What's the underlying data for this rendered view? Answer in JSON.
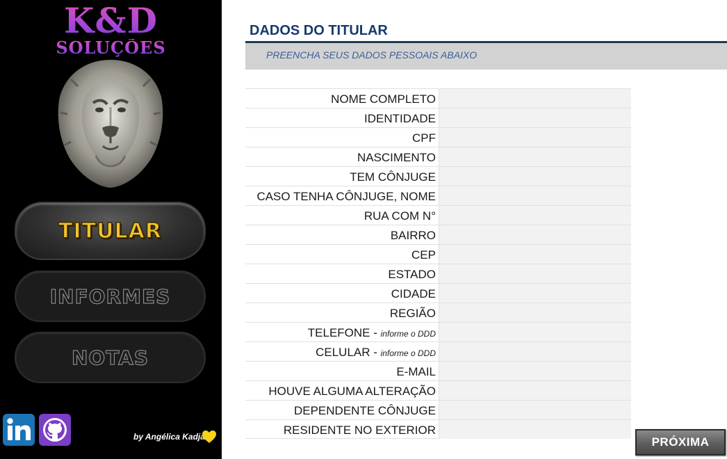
{
  "sidebar": {
    "logo": {
      "main": "K&D",
      "sub": "SOLUÇÕES"
    },
    "nav": [
      {
        "label": "TITULAR",
        "active": true
      },
      {
        "label": "INFORMES",
        "active": false
      },
      {
        "label": "NOTAS",
        "active": false
      }
    ],
    "social": [
      {
        "icon": "linkedin-icon"
      },
      {
        "icon": "github-icon"
      }
    ],
    "credit": "by Angélica Kadja",
    "credit_icon": "yellow-heart-icon"
  },
  "main": {
    "title": "DADOS DO TITULAR",
    "subtitle": "PREENCHA SEUS DADOS PESSOAIS ABAIXO",
    "fields": [
      {
        "label": "NOME COMPLETO",
        "hint": "",
        "value": ""
      },
      {
        "label": "IDENTIDADE",
        "hint": "",
        "value": ""
      },
      {
        "label": "CPF",
        "hint": "",
        "value": ""
      },
      {
        "label": "NASCIMENTO",
        "hint": "",
        "value": ""
      },
      {
        "label": "TEM CÔNJUGE",
        "hint": "",
        "value": ""
      },
      {
        "label": "CASO TENHA CÔNJUGE, NOME",
        "hint": "",
        "value": ""
      },
      {
        "label": "RUA COM N°",
        "hint": "",
        "value": ""
      },
      {
        "label": "BAIRRO",
        "hint": "",
        "value": ""
      },
      {
        "label": "CEP",
        "hint": "",
        "value": ""
      },
      {
        "label": "ESTADO",
        "hint": "",
        "value": ""
      },
      {
        "label": "CIDADE",
        "hint": "",
        "value": ""
      },
      {
        "label": "REGIÃO",
        "hint": "",
        "value": ""
      },
      {
        "label": "TELEFONE - ",
        "hint": "informe o DDD",
        "value": ""
      },
      {
        "label": "CELULAR - ",
        "hint": "informe o DDD",
        "value": ""
      },
      {
        "label": "E-MAIL",
        "hint": "",
        "value": ""
      },
      {
        "label": "HOUVE ALGUMA ALTERAÇÃO",
        "hint": "",
        "value": ""
      },
      {
        "label": "DEPENDENTE CÔNJUGE",
        "hint": "",
        "value": ""
      },
      {
        "label": "RESIDENTE NO EXTERIOR",
        "hint": "",
        "value": ""
      }
    ],
    "next_label": "PRÓXIMA"
  },
  "colors": {
    "title": "#173a6b",
    "subtitle": "#3b5e9a",
    "accent_gold": "#f2c230",
    "logo_purple": "#b44fd6"
  }
}
